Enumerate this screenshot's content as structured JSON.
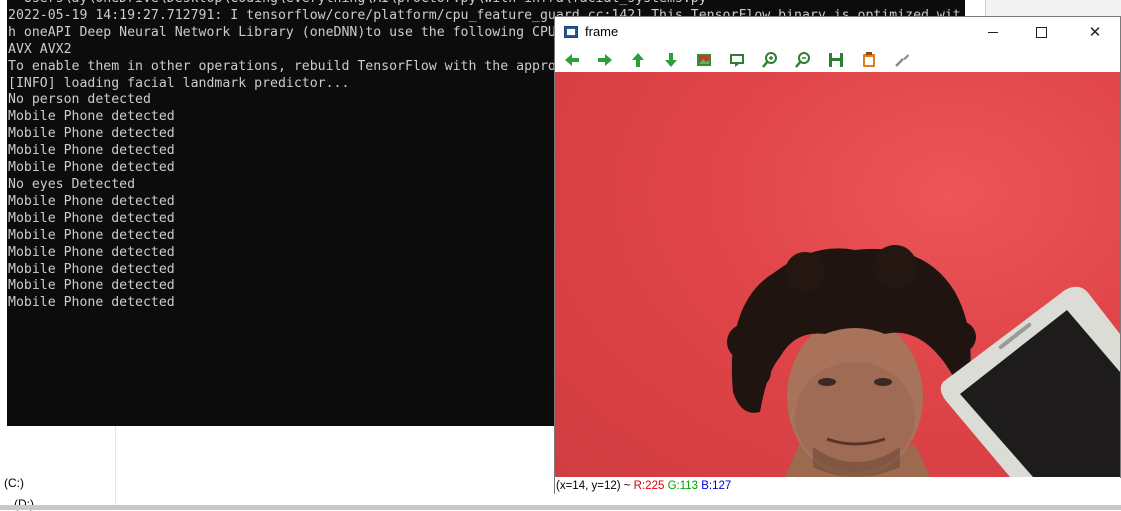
{
  "background": {
    "drive_c_label": "(C:)",
    "drive_d_label": "(D:)"
  },
  "console": {
    "lines": [
      "  Users\\ay\\OneDrive\\Desktop\\Coding\\everything\\AI\\proctor.py\\with-infra\\facial_systems.py",
      "2022-05-19 14:19:27.712791: I tensorflow/core/platform/cpu_feature_guard.cc:142] This TensorFlow binary is optimized wit",
      "h oneAPI Deep Neural Network Library (oneDNN)to use the following CPU instructions in performance-critical operations:",
      "AVX AVX2",
      "To enable them in other operations, rebuild TensorFlow with the appropriate compiler flags.",
      "[INFO] loading facial landmark predictor...",
      "No person detected",
      "Mobile Phone detected",
      "Mobile Phone detected",
      "Mobile Phone detected",
      "Mobile Phone detected",
      "No eyes Detected",
      "Mobile Phone detected",
      "Mobile Phone detected",
      "Mobile Phone detected",
      "Mobile Phone detected",
      "Mobile Phone detected",
      "Mobile Phone detected",
      "Mobile Phone detected"
    ]
  },
  "frame_window": {
    "title": "frame",
    "minimize_glyph": "—",
    "close_glyph": "✕",
    "toolbar": [
      {
        "icon": "arrow-left-icon",
        "color": "#2e9e3a"
      },
      {
        "icon": "arrow-right-icon",
        "color": "#2e9e3a"
      },
      {
        "icon": "arrow-up-icon",
        "color": "#2e9e3a"
      },
      {
        "icon": "arrow-down-icon",
        "color": "#2e9e3a"
      },
      {
        "icon": "image-icon",
        "color": "#3a8a3a"
      },
      {
        "icon": "zoom-fit-icon",
        "color": "#2e7d32"
      },
      {
        "icon": "zoom-in-icon",
        "color": "#2e7d32"
      },
      {
        "icon": "zoom-out-icon",
        "color": "#2e7d32"
      },
      {
        "icon": "save-icon",
        "color": "#2e7d32"
      },
      {
        "icon": "copy-icon",
        "color": "#e07a1f"
      },
      {
        "icon": "properties-icon",
        "color": "#888888"
      }
    ],
    "status": {
      "coord": "(x=14, y=12) ~ ",
      "r": "R:225",
      "g": "G:113",
      "b": "B:127"
    }
  }
}
